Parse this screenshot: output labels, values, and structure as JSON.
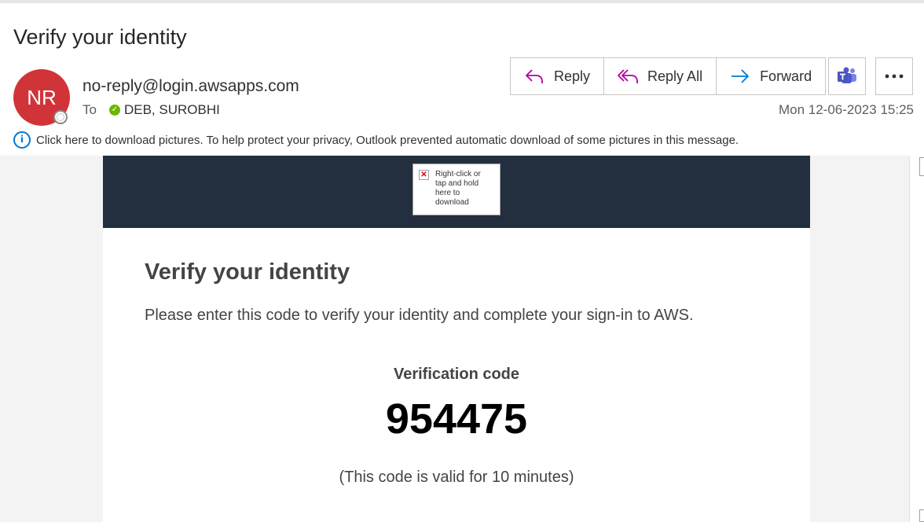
{
  "email": {
    "subject": "Verify your identity",
    "avatar_initials": "NR",
    "sender": "no-reply@login.awsapps.com",
    "to_label": "To",
    "recipient": "DEB, SUROBHI",
    "date": "Mon 12-06-2023 15:25",
    "info_bar": "Click here to download pictures. To help protect your privacy, Outlook prevented automatic download of some pictures in this message."
  },
  "actions": {
    "reply": "Reply",
    "reply_all": "Reply All",
    "forward": "Forward",
    "teams_icon": "teams-icon",
    "more_icon": "more-options-icon"
  },
  "body": {
    "image_placeholder": "Right-click or tap and hold here to download",
    "title": "Verify your identity",
    "description": "Please enter this code to verify your identity and complete your sign-in to AWS.",
    "code_label": "Verification code",
    "code": "954475",
    "validity": "(This code is valid for 10 minutes)"
  },
  "colors": {
    "avatar": "#d13438",
    "banner": "#232f3e",
    "accent": "#0078d4",
    "reply_icon": "#b4009e"
  }
}
